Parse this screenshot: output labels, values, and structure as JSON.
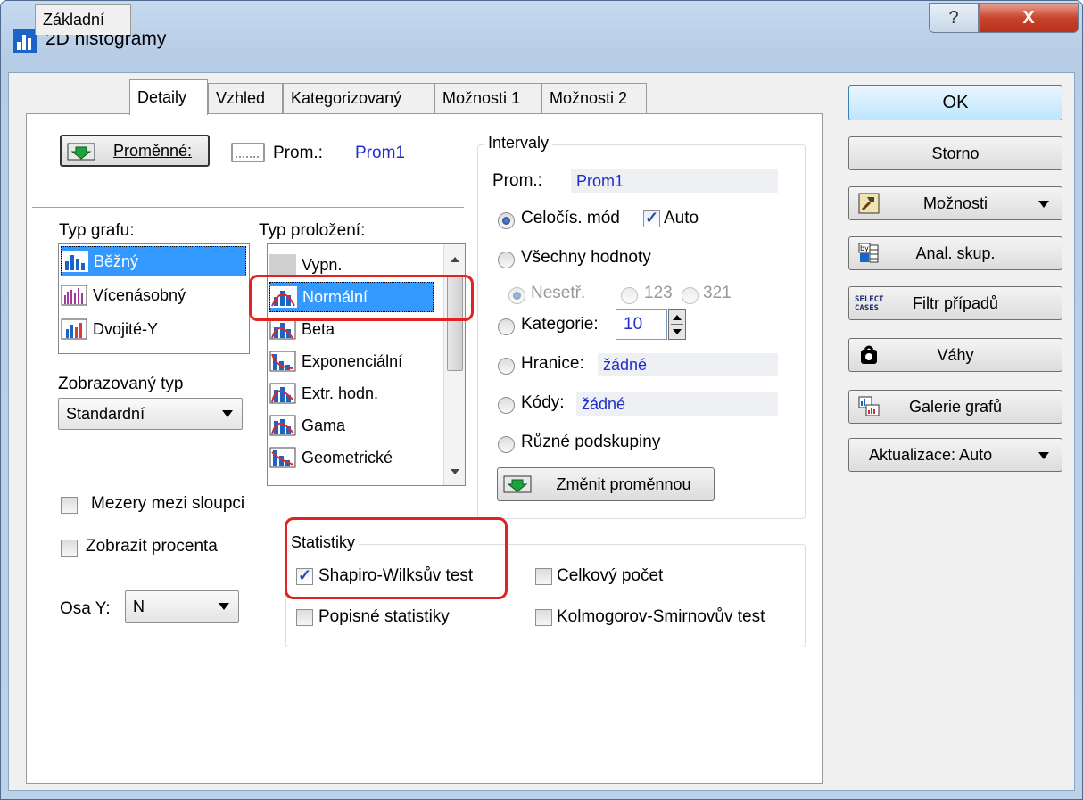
{
  "window": {
    "title": "2D histogramy",
    "help_glyph": "?",
    "close_glyph": "X"
  },
  "tabs": [
    "Základní",
    "Detaily",
    "Vzhled",
    "Kategorizovaný",
    "Možnosti 1",
    "Možnosti 2"
  ],
  "active_tab": "Detaily",
  "variables": {
    "button_label": "Proměnné:",
    "prom_label": "Prom.:",
    "prom_value": "Prom1"
  },
  "graph_type": {
    "label": "Typ grafu:",
    "items": [
      "Běžný",
      "Vícenásobný",
      "Dvojité-Y"
    ],
    "selected": "Běžný"
  },
  "fit_type": {
    "label": "Typ proložení:",
    "items": [
      "Vypn.",
      "Normální",
      "Beta",
      "Exponenciální",
      "Extr. hodn.",
      "Gama",
      "Geometrické"
    ],
    "selected": "Normální"
  },
  "display_type": {
    "label": "Zobrazovaný typ",
    "value": "Standardní"
  },
  "options": {
    "gaps_label": "Mezery mezi sloupci",
    "gaps_checked": false,
    "percent_label": "Zobrazit procenta",
    "percent_checked": false,
    "axis_y_label": "Osa Y:",
    "axis_y_value": "N"
  },
  "intervals": {
    "label": "Intervaly",
    "prom_label": "Prom.:",
    "prom_value": "Prom1",
    "integer_mode_label": "Celočís. mód",
    "auto_label": "Auto",
    "auto_checked": true,
    "all_values_label": "Všechny hodnoty",
    "unsorted_label": "Nesetř.",
    "asc_label": "123",
    "desc_label": "321",
    "categories_label": "Kategorie:",
    "categories_value": "10",
    "bounds_label": "Hranice:",
    "bounds_value": "žádné",
    "codes_label": "Kódy:",
    "codes_value": "žádné",
    "subgroups_label": "Různé podskupiny",
    "change_var_label": "Změnit proměnnou",
    "selected_mode": "Celočís. mód"
  },
  "statistics": {
    "label": "Statistiky",
    "shapiro_label": "Shapiro-Wilksův test",
    "shapiro_checked": true,
    "total_label": "Celkový počet",
    "total_checked": false,
    "desc_label": "Popisné statistiky",
    "desc_checked": false,
    "ks_label": "Kolmogorov-Smirnovův test",
    "ks_checked": false
  },
  "side_buttons": {
    "ok": "OK",
    "cancel": "Storno",
    "options": "Možnosti",
    "group_analysis": "Anal. skup.",
    "case_filter": "Filtr případů",
    "weights": "Váhy",
    "graph_gallery": "Galerie grafů",
    "update": "Aktualizace: Auto"
  },
  "select_cases_icon_text": [
    "SELECT",
    "CASES"
  ],
  "colors": {
    "accent_blue": "#1f2fcc",
    "selection": "#3399ff",
    "highlight_red": "#e0241f"
  }
}
